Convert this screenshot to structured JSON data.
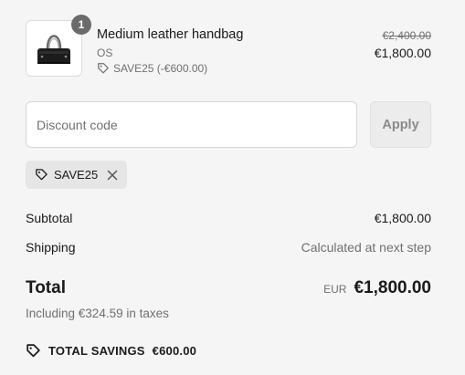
{
  "line_item": {
    "quantity": "1",
    "title": "Medium leather handbag",
    "variant": "OS",
    "discount_label": "SAVE25 (-€600.00)",
    "original_price": "€2,400.00",
    "price": "€1,800.00"
  },
  "discount": {
    "placeholder": "Discount code",
    "value": "",
    "apply_label": "Apply",
    "applied_code": "SAVE25"
  },
  "summary": {
    "subtotal_label": "Subtotal",
    "subtotal_value": "€1,800.00",
    "shipping_label": "Shipping",
    "shipping_value": "Calculated at next step",
    "total_label": "Total",
    "currency": "EUR",
    "total_value": "€1,800.00",
    "taxes_note": "Including €324.59 in taxes",
    "savings_label": "TOTAL SAVINGS",
    "savings_value": "€600.00"
  },
  "icons": {
    "discount_tag": "tag-icon",
    "remove": "close-icon",
    "product": "handbag-thumbnail"
  }
}
